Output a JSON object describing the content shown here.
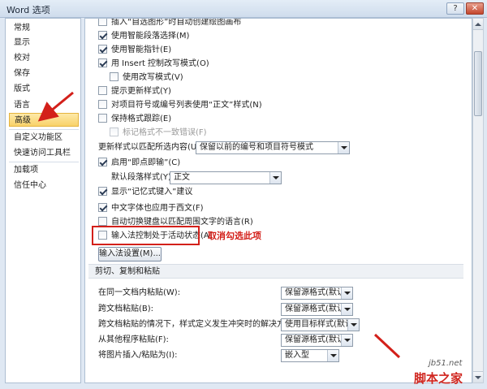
{
  "window": {
    "title": "Word 选项",
    "help_glyph": "?",
    "close_glyph": "✕"
  },
  "sidebar": {
    "items": [
      {
        "label": "常规"
      },
      {
        "label": "显示"
      },
      {
        "label": "校对"
      },
      {
        "label": "保存"
      },
      {
        "label": "版式"
      },
      {
        "label": "语言"
      },
      {
        "label": "高级",
        "selected": true
      },
      {
        "label": "自定义功能区"
      },
      {
        "label": "快速访问工具栏"
      },
      {
        "label": "加载项"
      },
      {
        "label": "信任中心"
      }
    ]
  },
  "editing": {
    "cb_insert_canvas": {
      "label": "插入“自选图形”时自动创建绘图画布",
      "checked": false
    },
    "cb_smart_paragraph": {
      "label": "使用智能段落选择(M)",
      "checked": true
    },
    "cb_smart_cursor": {
      "label": "使用智能指针(E)",
      "checked": true
    },
    "cb_insert_key": {
      "label": "用 Insert 控制改写模式(O)",
      "checked": true
    },
    "cb_overtype": {
      "label": "使用改写模式(V)",
      "checked": false
    },
    "cb_prompt_style": {
      "label": "提示更新样式(Y)",
      "checked": false
    },
    "cb_normal_style": {
      "label": "对项目符号或编号列表使用“正文”样式(N)",
      "checked": false
    },
    "cb_track_format": {
      "label": "保持格式跟踪(E)",
      "checked": false
    },
    "cb_mark_inconsistency": {
      "label": "标记格式不一致错误(F)",
      "checked": false
    },
    "update_style_label": "更新样式以匹配所选内容(U):",
    "update_style_value": "保留以前的编号和项目符号模式",
    "cb_click_type": {
      "label": "启用“即点即输”(C)",
      "checked": true
    },
    "default_para_label": "默认段落样式(Y):",
    "default_para_value": "正文",
    "cb_autocomplete": {
      "label": "显示“记忆式键入”建议",
      "checked": true
    },
    "cb_chinese_font": {
      "label": "中文字体也应用于西文(F)",
      "checked": true
    },
    "cb_auto_keyboard": {
      "label": "自动切换键盘以匹配周围文字的语言(R)",
      "checked": false
    },
    "cb_ime_active": {
      "label": "输入法控制处于活动状态(A)",
      "checked": false
    },
    "ime_settings_button": "输入法设置(M)...",
    "annotation": "取消勾选此项"
  },
  "paste_section": {
    "title": "剪切、复制和粘贴",
    "rows": [
      {
        "label": "在同一文档内粘贴(W):",
        "value": "保留源格式(默认)"
      },
      {
        "label": "跨文档粘贴(B):",
        "value": "保留源格式(默认)"
      },
      {
        "label": "跨文档粘贴的情况下，样式定义发生冲突时的解决方法(E):",
        "value": "使用目标样式(默认)"
      },
      {
        "label": "从其他程序粘贴(F):",
        "value": "保留源格式(默认)"
      },
      {
        "label": "将图片插入/粘贴为(I):",
        "value": "嵌入型"
      }
    ]
  },
  "watermark": {
    "url": "jb51.net",
    "name": "脚本之家"
  },
  "colors": {
    "annotation_red": "#d3201a",
    "selected_nav": "#f8d26a"
  }
}
